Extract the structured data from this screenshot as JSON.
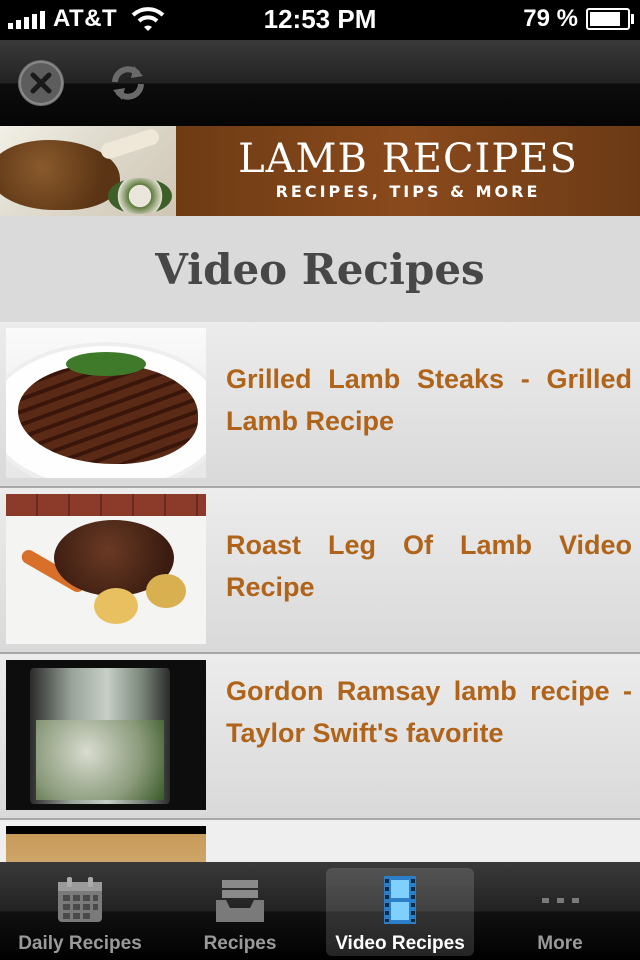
{
  "status_bar": {
    "carrier": "AT&T",
    "time": "12:53 PM",
    "battery_percent": "79 %",
    "battery_level": 0.79
  },
  "toolbar": {
    "close_icon": "close-circle-icon",
    "reload_icon": "reload-icon"
  },
  "banner": {
    "title": "LAMB RECIPES",
    "subtitle": "RECIPES, TIPS & MORE"
  },
  "page": {
    "title": "Video Recipes"
  },
  "videos": [
    {
      "title": "Grilled Lamb Steaks - Grilled Lamb Recipe"
    },
    {
      "title": "Roast Leg Of Lamb Video Recipe"
    },
    {
      "title": "Gordon Ramsay lamb recipe -Taylor Swift's favorite"
    }
  ],
  "tabs": [
    {
      "label": "Daily Recipes",
      "icon": "calendar-icon",
      "active": false
    },
    {
      "label": "Recipes",
      "icon": "inbox-tray-icon",
      "active": false
    },
    {
      "label": "Video Recipes",
      "icon": "film-strip-icon",
      "active": true
    },
    {
      "label": "More",
      "icon": "more-dots-icon",
      "active": false
    }
  ],
  "colors": {
    "accent_title": "#b0641a",
    "banner_bg": "#7a4219",
    "active_tab_icon": "#5cb8f0"
  }
}
